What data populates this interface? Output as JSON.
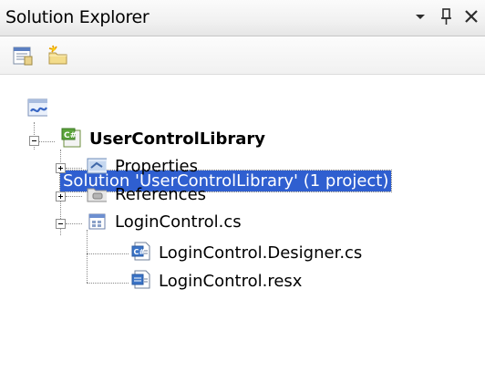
{
  "window": {
    "title": "Solution Explorer",
    "controls": [
      "dropdown-icon",
      "pin-icon",
      "close-icon"
    ]
  },
  "toolbar": {
    "buttons": [
      {
        "name": "properties-button",
        "icon": "properties-icon"
      },
      {
        "name": "new-folder-button",
        "icon": "new-folder-icon"
      }
    ]
  },
  "tree": {
    "solution": "Solution 'UserControlLibrary' (1 project)",
    "project": "UserControlLibrary",
    "properties": "Properties",
    "references": "References",
    "login_control": "LoginControl.cs",
    "designer": "LoginControl.Designer.cs",
    "resx": "LoginControl.resx"
  },
  "colors": {
    "selection": "#2f5fd0",
    "title_bg": "#f1f1f1"
  }
}
